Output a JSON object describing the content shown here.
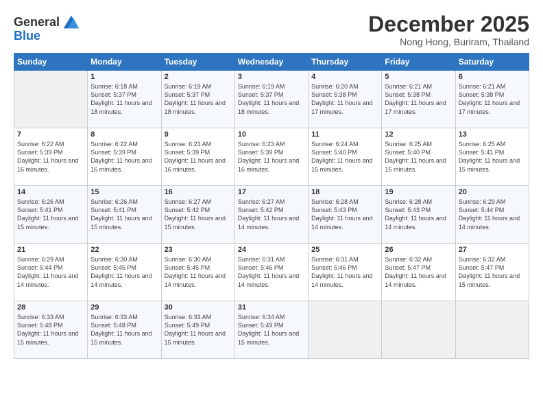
{
  "logo": {
    "line1": "General",
    "line2": "Blue"
  },
  "header": {
    "month": "December 2025",
    "location": "Nong Hong, Buriram, Thailand"
  },
  "days_of_week": [
    "Sunday",
    "Monday",
    "Tuesday",
    "Wednesday",
    "Thursday",
    "Friday",
    "Saturday"
  ],
  "weeks": [
    [
      {
        "day": "",
        "sunrise": "",
        "sunset": "",
        "daylight": ""
      },
      {
        "day": "1",
        "sunrise": "Sunrise: 6:18 AM",
        "sunset": "Sunset: 5:37 PM",
        "daylight": "Daylight: 11 hours and 18 minutes."
      },
      {
        "day": "2",
        "sunrise": "Sunrise: 6:19 AM",
        "sunset": "Sunset: 5:37 PM",
        "daylight": "Daylight: 11 hours and 18 minutes."
      },
      {
        "day": "3",
        "sunrise": "Sunrise: 6:19 AM",
        "sunset": "Sunset: 5:37 PM",
        "daylight": "Daylight: 11 hours and 18 minutes."
      },
      {
        "day": "4",
        "sunrise": "Sunrise: 6:20 AM",
        "sunset": "Sunset: 5:38 PM",
        "daylight": "Daylight: 11 hours and 17 minutes."
      },
      {
        "day": "5",
        "sunrise": "Sunrise: 6:21 AM",
        "sunset": "Sunset: 5:38 PM",
        "daylight": "Daylight: 11 hours and 17 minutes."
      },
      {
        "day": "6",
        "sunrise": "Sunrise: 6:21 AM",
        "sunset": "Sunset: 5:38 PM",
        "daylight": "Daylight: 11 hours and 17 minutes."
      }
    ],
    [
      {
        "day": "7",
        "sunrise": "Sunrise: 6:22 AM",
        "sunset": "Sunset: 5:39 PM",
        "daylight": "Daylight: 11 hours and 16 minutes."
      },
      {
        "day": "8",
        "sunrise": "Sunrise: 6:22 AM",
        "sunset": "Sunset: 5:39 PM",
        "daylight": "Daylight: 11 hours and 16 minutes."
      },
      {
        "day": "9",
        "sunrise": "Sunrise: 6:23 AM",
        "sunset": "Sunset: 5:39 PM",
        "daylight": "Daylight: 11 hours and 16 minutes."
      },
      {
        "day": "10",
        "sunrise": "Sunrise: 6:23 AM",
        "sunset": "Sunset: 5:39 PM",
        "daylight": "Daylight: 11 hours and 16 minutes."
      },
      {
        "day": "11",
        "sunrise": "Sunrise: 6:24 AM",
        "sunset": "Sunset: 5:40 PM",
        "daylight": "Daylight: 11 hours and 15 minutes."
      },
      {
        "day": "12",
        "sunrise": "Sunrise: 6:25 AM",
        "sunset": "Sunset: 5:40 PM",
        "daylight": "Daylight: 11 hours and 15 minutes."
      },
      {
        "day": "13",
        "sunrise": "Sunrise: 6:25 AM",
        "sunset": "Sunset: 5:41 PM",
        "daylight": "Daylight: 11 hours and 15 minutes."
      }
    ],
    [
      {
        "day": "14",
        "sunrise": "Sunrise: 6:26 AM",
        "sunset": "Sunset: 5:41 PM",
        "daylight": "Daylight: 11 hours and 15 minutes."
      },
      {
        "day": "15",
        "sunrise": "Sunrise: 6:26 AM",
        "sunset": "Sunset: 5:41 PM",
        "daylight": "Daylight: 11 hours and 15 minutes."
      },
      {
        "day": "16",
        "sunrise": "Sunrise: 6:27 AM",
        "sunset": "Sunset: 5:42 PM",
        "daylight": "Daylight: 11 hours and 15 minutes."
      },
      {
        "day": "17",
        "sunrise": "Sunrise: 6:27 AM",
        "sunset": "Sunset: 5:42 PM",
        "daylight": "Daylight: 11 hours and 14 minutes."
      },
      {
        "day": "18",
        "sunrise": "Sunrise: 6:28 AM",
        "sunset": "Sunset: 5:43 PM",
        "daylight": "Daylight: 11 hours and 14 minutes."
      },
      {
        "day": "19",
        "sunrise": "Sunrise: 6:28 AM",
        "sunset": "Sunset: 5:43 PM",
        "daylight": "Daylight: 11 hours and 14 minutes."
      },
      {
        "day": "20",
        "sunrise": "Sunrise: 6:29 AM",
        "sunset": "Sunset: 5:44 PM",
        "daylight": "Daylight: 11 hours and 14 minutes."
      }
    ],
    [
      {
        "day": "21",
        "sunrise": "Sunrise: 6:29 AM",
        "sunset": "Sunset: 5:44 PM",
        "daylight": "Daylight: 11 hours and 14 minutes."
      },
      {
        "day": "22",
        "sunrise": "Sunrise: 6:30 AM",
        "sunset": "Sunset: 5:45 PM",
        "daylight": "Daylight: 11 hours and 14 minutes."
      },
      {
        "day": "23",
        "sunrise": "Sunrise: 6:30 AM",
        "sunset": "Sunset: 5:45 PM",
        "daylight": "Daylight: 11 hours and 14 minutes."
      },
      {
        "day": "24",
        "sunrise": "Sunrise: 6:31 AM",
        "sunset": "Sunset: 5:46 PM",
        "daylight": "Daylight: 11 hours and 14 minutes."
      },
      {
        "day": "25",
        "sunrise": "Sunrise: 6:31 AM",
        "sunset": "Sunset: 5:46 PM",
        "daylight": "Daylight: 11 hours and 14 minutes."
      },
      {
        "day": "26",
        "sunrise": "Sunrise: 6:32 AM",
        "sunset": "Sunset: 5:47 PM",
        "daylight": "Daylight: 11 hours and 14 minutes."
      },
      {
        "day": "27",
        "sunrise": "Sunrise: 6:32 AM",
        "sunset": "Sunset: 5:47 PM",
        "daylight": "Daylight: 11 hours and 15 minutes."
      }
    ],
    [
      {
        "day": "28",
        "sunrise": "Sunrise: 6:33 AM",
        "sunset": "Sunset: 5:48 PM",
        "daylight": "Daylight: 11 hours and 15 minutes."
      },
      {
        "day": "29",
        "sunrise": "Sunrise: 6:33 AM",
        "sunset": "Sunset: 5:48 PM",
        "daylight": "Daylight: 11 hours and 15 minutes."
      },
      {
        "day": "30",
        "sunrise": "Sunrise: 6:33 AM",
        "sunset": "Sunset: 5:49 PM",
        "daylight": "Daylight: 11 hours and 15 minutes."
      },
      {
        "day": "31",
        "sunrise": "Sunrise: 6:34 AM",
        "sunset": "Sunset: 5:49 PM",
        "daylight": "Daylight: 11 hours and 15 minutes."
      },
      {
        "day": "",
        "sunrise": "",
        "sunset": "",
        "daylight": ""
      },
      {
        "day": "",
        "sunrise": "",
        "sunset": "",
        "daylight": ""
      },
      {
        "day": "",
        "sunrise": "",
        "sunset": "",
        "daylight": ""
      }
    ]
  ]
}
